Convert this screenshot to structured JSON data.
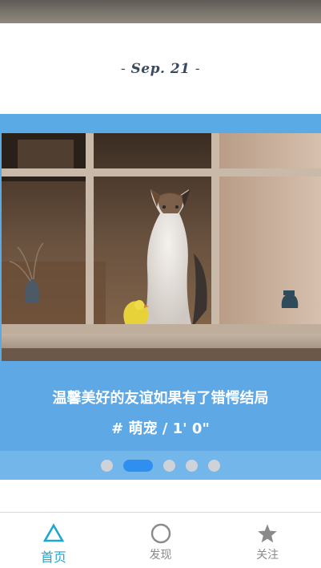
{
  "date": {
    "prefix": "-",
    "text": "Sep. 21",
    "suffix": "-"
  },
  "card": {
    "image_alt": "A calico cat and a small yellow chick sitting by a wooden window",
    "title": "温馨美好的友谊如果有了错愕结局",
    "meta": "# 萌宠 / 1' 0\"",
    "accent_color": "#5aaae6"
  },
  "carousel": {
    "count": 5,
    "active_index": 1,
    "active_color": "#2f8ff0",
    "inactive_color": "#cfd3d8"
  },
  "tabbar": {
    "tabs": [
      {
        "label": "首页",
        "icon": "triangle-icon",
        "active": true
      },
      {
        "label": "发现",
        "icon": "circle-icon",
        "active": false
      },
      {
        "label": "关注",
        "icon": "star-icon",
        "active": false
      }
    ],
    "active_color": "#1ea7d4",
    "inactive_color": "#8a8a8a"
  }
}
